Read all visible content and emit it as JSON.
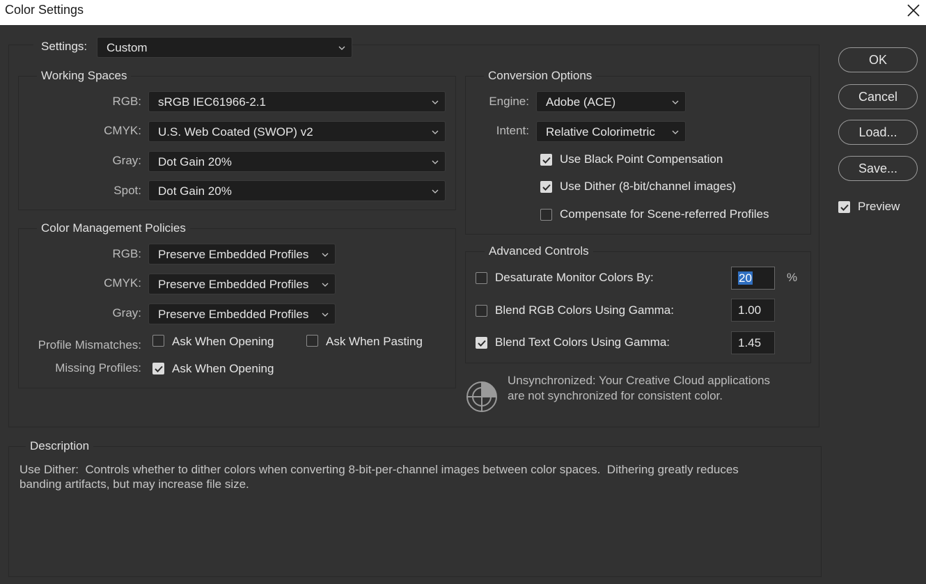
{
  "window": {
    "title": "Color Settings"
  },
  "settings": {
    "label": "Settings:",
    "value": "Custom"
  },
  "working_spaces": {
    "title": "Working Spaces",
    "rows": [
      {
        "label": "RGB:",
        "value": "sRGB IEC61966-2.1"
      },
      {
        "label": "CMYK:",
        "value": "U.S. Web Coated (SWOP) v2"
      },
      {
        "label": "Gray:",
        "value": "Dot Gain 20%"
      },
      {
        "label": "Spot:",
        "value": "Dot Gain 20%"
      }
    ]
  },
  "policies": {
    "title": "Color Management Policies",
    "rows": [
      {
        "label": "RGB:",
        "value": "Preserve Embedded Profiles"
      },
      {
        "label": "CMYK:",
        "value": "Preserve Embedded Profiles"
      },
      {
        "label": "Gray:",
        "value": "Preserve Embedded Profiles"
      }
    ],
    "profile_mismatches": {
      "label": "Profile Mismatches:",
      "ask_opening": {
        "label": "Ask When Opening",
        "checked": false
      },
      "ask_pasting": {
        "label": "Ask When Pasting",
        "checked": false
      }
    },
    "missing_profiles": {
      "label": "Missing Profiles:",
      "ask_opening": {
        "label": "Ask When Opening",
        "checked": true
      }
    }
  },
  "conversion": {
    "title": "Conversion Options",
    "engine": {
      "label": "Engine:",
      "value": "Adobe (ACE)"
    },
    "intent": {
      "label": "Intent:",
      "value": "Relative Colorimetric"
    },
    "black_point": {
      "label": "Use Black Point Compensation",
      "checked": true
    },
    "dither": {
      "label": "Use Dither (8-bit/channel images)",
      "checked": true
    },
    "scene_referred": {
      "label": "Compensate for Scene-referred Profiles",
      "checked": false
    }
  },
  "advanced": {
    "title": "Advanced Controls",
    "desaturate": {
      "label": "Desaturate Monitor Colors By:",
      "checked": false,
      "value": "20",
      "unit": "%"
    },
    "blend_rgb": {
      "label": "Blend RGB Colors Using Gamma:",
      "checked": false,
      "value": "1.00"
    },
    "blend_text": {
      "label": "Blend Text Colors Using Gamma:",
      "checked": true,
      "value": "1.45"
    }
  },
  "sync": {
    "icon": "sync-status-icon",
    "line1": "Unsynchronized: Your Creative Cloud applications",
    "line2": "are not synchronized for consistent color."
  },
  "buttons": {
    "ok": "OK",
    "cancel": "Cancel",
    "load": "Load...",
    "save": "Save..."
  },
  "preview": {
    "label": "Preview",
    "checked": true
  },
  "description": {
    "title": "Description",
    "line1": "Use Dither:  Controls whether to dither colors when converting 8-bit-per-channel images between color spaces.  Dithering greatly reduces",
    "line2": "banding artifacts, but may increase file size."
  },
  "colors": {
    "background": "#323232",
    "selection": "#2f6fc1",
    "field": "#1e1e1e"
  }
}
